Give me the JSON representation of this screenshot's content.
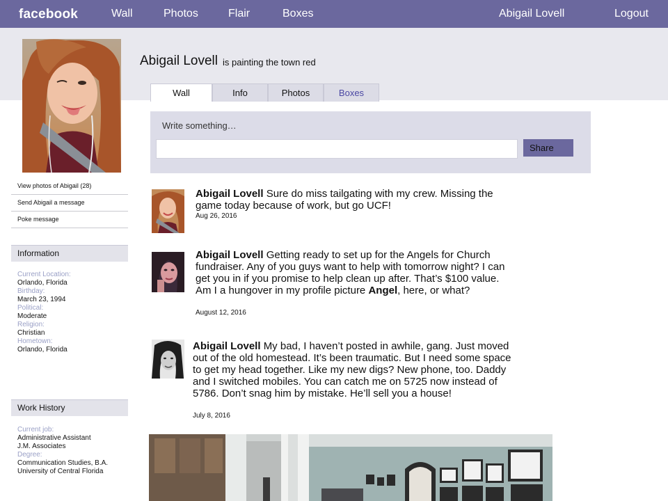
{
  "header": {
    "logo": "facebook",
    "nav": [
      "Wall",
      "Photos",
      "Flair",
      "Boxes"
    ],
    "user_name": "Abigail Lovell",
    "logout": "Logout"
  },
  "profile": {
    "name": "Abigail Lovell",
    "status": "is painting the town red"
  },
  "tabs": [
    "Wall",
    "Info",
    "Photos",
    "Boxes"
  ],
  "composer": {
    "prompt": "Write something…",
    "input_value": "",
    "share_label": "Share"
  },
  "left_links": [
    "View photos of Abigail  (28)",
    "Send Abigail  a message",
    "Poke message"
  ],
  "information": {
    "heading": "Information",
    "fields": [
      {
        "label": "Current Location:",
        "value": "Orlando, Florida"
      },
      {
        "label": "Birthday:",
        "value": "March 23, 1994"
      },
      {
        "label": "Political:",
        "value": "Moderate"
      },
      {
        "label": "Religion:",
        "value": "Christian"
      },
      {
        "label": "Hometown:",
        "value": "Orlando, Florida"
      }
    ]
  },
  "work_history": {
    "heading": "Work History",
    "current_job_label": "Current job:",
    "current_job_lines": [
      "Administrative Assistant",
      "J.M. Associates"
    ],
    "degree_label": "Degree:",
    "degree_lines": [
      "Communication Studies, B.A.",
      "University of Central Florida"
    ]
  },
  "posts": [
    {
      "author": "Abigail Lovell",
      "text": "Sure do miss tailgating with my crew. Missing the game today because of work, but go UCF!",
      "date": "Aug 26, 2016"
    },
    {
      "author": "Abigail Lovell",
      "text_before": "Getting ready to set up for the Angels for Church fundraiser. Any of you guys want to help with tomorrow night? I can get you in if you promise to help clean up after. That’s $100 value.  Am I a hungover in my profile picture ",
      "bold_word": "Angel",
      "text_after": ", here, or what?",
      "date": "August 12, 2016"
    },
    {
      "author": "Abigail Lovell",
      "text": "My bad, I haven’t posted in awhile, gang. Just moved out of the old homestead. It’s been traumatic. But I need some space to get my head together. Like my new digs? New phone, too. Daddy and I switched mobiles. You can catch me on 5725 now instead of 5786. Don’t snag him by mistake. He’ll sell you a house!",
      "date": "July 8, 2016"
    }
  ],
  "colors": {
    "topbar": "#6b689e",
    "band": "#e8e8ee",
    "label_blue": "#9aa0c6",
    "boxes_tab": "#4a47a3"
  }
}
